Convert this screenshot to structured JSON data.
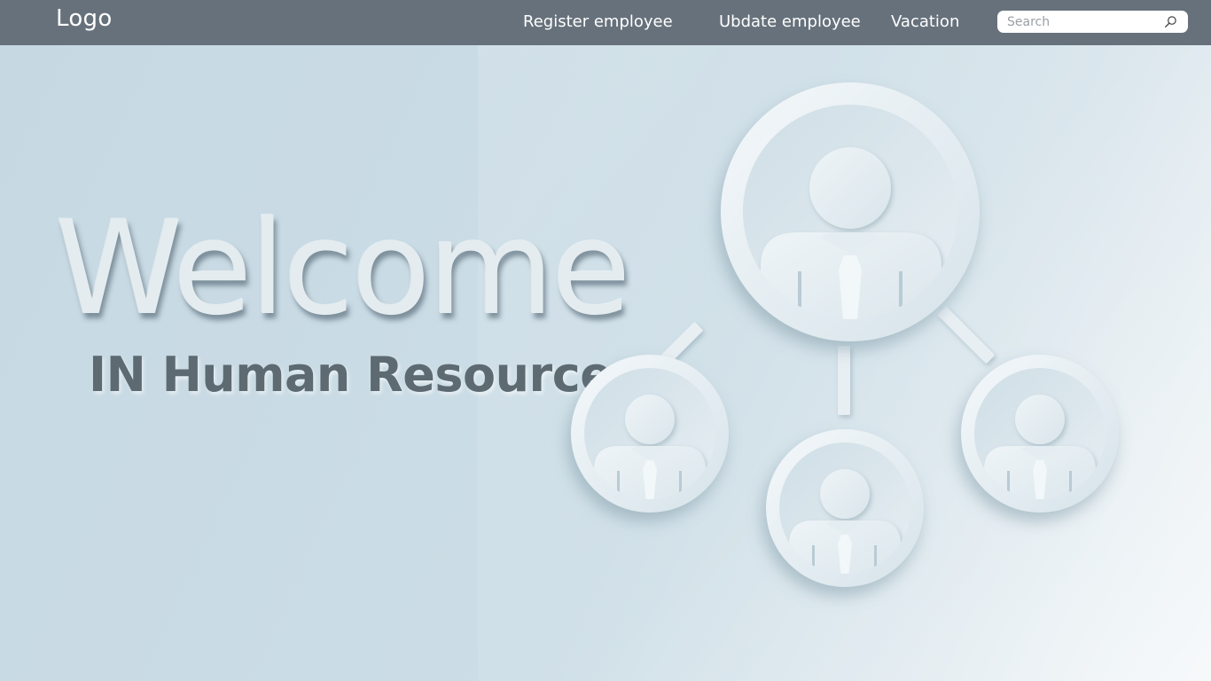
{
  "header": {
    "logo": "Logo",
    "nav": [
      {
        "label": "Register employee"
      },
      {
        "label": "Ubdate employee"
      },
      {
        "label": "Vacation"
      }
    ],
    "search": {
      "placeholder": "Search",
      "value": "",
      "icon": "search-icon"
    }
  },
  "hero": {
    "title": "Welcome",
    "subtitle": "IN Human Resource"
  },
  "colors": {
    "header_bg": "#66717b",
    "page_bg": "#cddde5",
    "subtitle": "#5d6a72"
  },
  "illustration": {
    "icon": "org-chart-people-icon"
  }
}
